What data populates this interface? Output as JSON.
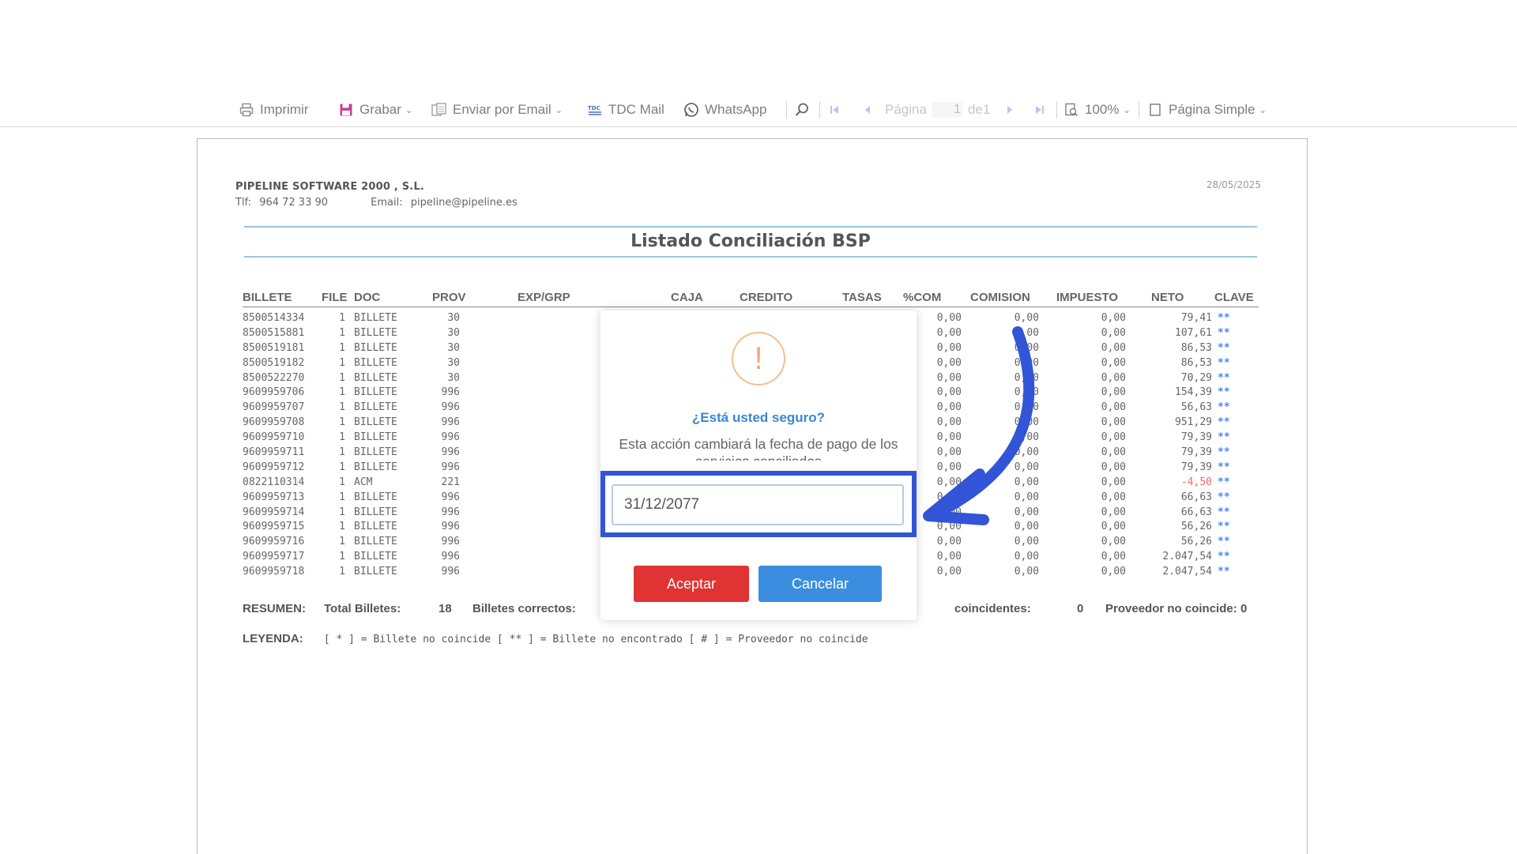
{
  "toolbar": {
    "print": "Imprimir",
    "save": "Grabar",
    "email": "Enviar por Email",
    "tdc": "TDC Mail",
    "whatsapp": "WhatsApp",
    "page_label": "Página",
    "page_value": "1",
    "page_of": "de1",
    "zoom": "100%",
    "view_mode": "Página Simple"
  },
  "report": {
    "company": "PIPELINE SOFTWARE 2000 , S.L.",
    "phone_label": "Tlf:",
    "phone": "964 72 33 90",
    "email_label": "Email:",
    "email": "pipeline@pipeline.es",
    "date": "28/05/2025",
    "title": "Listado Conciliación BSP",
    "columns": {
      "billete": "BILLETE",
      "file": "FILE",
      "doc": "DOC",
      "prov": "PROV",
      "expgrp": "EXP/GRP",
      "caja": "CAJA",
      "credito": "CREDITO",
      "tasas": "TASAS",
      "pcom": "%COM",
      "comision": "COMISION",
      "impuesto": "IMPUESTO",
      "neto": "NETO",
      "clave": "CLAVE"
    },
    "rows": [
      {
        "billete": "8500514334",
        "file": "1",
        "doc": "BILLETE",
        "prov": "30",
        "pcom": "0,00",
        "comision": "0,00",
        "impuesto": "0,00",
        "neto": "79,41",
        "clave": "**"
      },
      {
        "billete": "8500515881",
        "file": "1",
        "doc": "BILLETE",
        "prov": "30",
        "pcom": "0,00",
        "comision": "0,00",
        "impuesto": "0,00",
        "neto": "107,61",
        "clave": "**"
      },
      {
        "billete": "8500519181",
        "file": "1",
        "doc": "BILLETE",
        "prov": "30",
        "pcom": "0,00",
        "comision": "0,00",
        "impuesto": "0,00",
        "neto": "86,53",
        "clave": "**"
      },
      {
        "billete": "8500519182",
        "file": "1",
        "doc": "BILLETE",
        "prov": "30",
        "pcom": "0,00",
        "comision": "0,00",
        "impuesto": "0,00",
        "neto": "86,53",
        "clave": "**"
      },
      {
        "billete": "8500522270",
        "file": "1",
        "doc": "BILLETE",
        "prov": "30",
        "pcom": "0,00",
        "comision": "0,00",
        "impuesto": "0,00",
        "neto": "70,29",
        "clave": "**"
      },
      {
        "billete": "9609959706",
        "file": "1",
        "doc": "BILLETE",
        "prov": "996",
        "pcom": "0,00",
        "comision": "0,00",
        "impuesto": "0,00",
        "neto": "154,39",
        "clave": "**"
      },
      {
        "billete": "9609959707",
        "file": "1",
        "doc": "BILLETE",
        "prov": "996",
        "pcom": "0,00",
        "comision": "0,00",
        "impuesto": "0,00",
        "neto": "56,63",
        "clave": "**"
      },
      {
        "billete": "9609959708",
        "file": "1",
        "doc": "BILLETE",
        "prov": "996",
        "pcom": "0,00",
        "comision": "0,00",
        "impuesto": "0,00",
        "neto": "951,29",
        "clave": "**"
      },
      {
        "billete": "9609959710",
        "file": "1",
        "doc": "BILLETE",
        "prov": "996",
        "pcom": "0,00",
        "comision": "0,00",
        "impuesto": "0,00",
        "neto": "79,39",
        "clave": "**"
      },
      {
        "billete": "9609959711",
        "file": "1",
        "doc": "BILLETE",
        "prov": "996",
        "pcom": "0,00",
        "comision": "0,00",
        "impuesto": "0,00",
        "neto": "79,39",
        "clave": "**"
      },
      {
        "billete": "9609959712",
        "file": "1",
        "doc": "BILLETE",
        "prov": "996",
        "pcom": "0,00",
        "comision": "0,00",
        "impuesto": "0,00",
        "neto": "79,39",
        "clave": "**"
      },
      {
        "billete": "0822110314",
        "file": "1",
        "doc": "ACM",
        "prov": "221",
        "pcom": "0,00",
        "comision": "0,00",
        "impuesto": "0,00",
        "neto": "-4,50",
        "clave": "**",
        "negative": true
      },
      {
        "billete": "9609959713",
        "file": "1",
        "doc": "BILLETE",
        "prov": "996",
        "pcom": "0,00",
        "comision": "0,00",
        "impuesto": "0,00",
        "neto": "66,63",
        "clave": "**"
      },
      {
        "billete": "9609959714",
        "file": "1",
        "doc": "BILLETE",
        "prov": "996",
        "pcom": "0,00",
        "comision": "0,00",
        "impuesto": "0,00",
        "neto": "66,63",
        "clave": "**"
      },
      {
        "billete": "9609959715",
        "file": "1",
        "doc": "BILLETE",
        "prov": "996",
        "pcom": "0,00",
        "comision": "0,00",
        "impuesto": "0,00",
        "neto": "56,26",
        "clave": "**"
      },
      {
        "billete": "9609959716",
        "file": "1",
        "doc": "BILLETE",
        "prov": "996",
        "pcom": "0,00",
        "comision": "0,00",
        "impuesto": "0,00",
        "neto": "56,26",
        "clave": "**"
      },
      {
        "billete": "9609959717",
        "file": "1",
        "doc": "BILLETE",
        "prov": "996",
        "pcom": "0,00",
        "comision": "0,00",
        "impuesto": "0,00",
        "neto": "2.047,54",
        "clave": "**"
      },
      {
        "billete": "9609959718",
        "file": "1",
        "doc": "BILLETE",
        "prov": "996",
        "pcom": "0,00",
        "comision": "0,00",
        "impuesto": "0,00",
        "neto": "2.047,54",
        "clave": "**"
      }
    ],
    "summary": {
      "label": "RESUMEN:",
      "total_label": "Total Billetes:",
      "total_value": "18",
      "correct_label": "Billetes correctos:",
      "nocoinc_label": "coincidentes:",
      "nocoinc_value": "0",
      "prov_label": "Proveedor no coincide:",
      "prov_value": "0"
    },
    "legend": {
      "label": "LEYENDA:",
      "text": "[ * ] = Billete no coincide  [ ** ] = Billete no encontrado  [ # ] = Proveedor no coincide"
    }
  },
  "dialog": {
    "icon_glyph": "!",
    "title": "¿Está usted seguro?",
    "message": "Esta acción cambiará la fecha de pago de los servicios conciliados",
    "input_value": "31/12/2077",
    "accept_label": "Aceptar",
    "cancel_label": "Cancelar"
  },
  "colors": {
    "accept": "#e03333",
    "cancel": "#3a8ee0",
    "highlight": "#3155d6",
    "warning": "#f3a877",
    "link_title": "#3b86d6"
  }
}
